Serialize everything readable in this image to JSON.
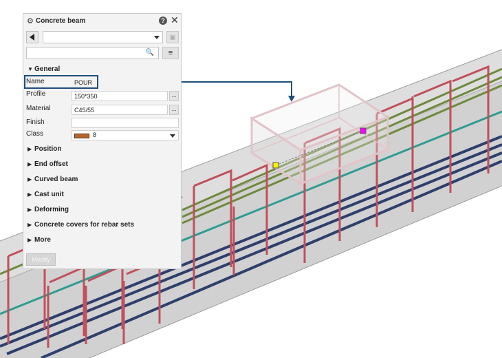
{
  "panel": {
    "title": "Concrete beam",
    "help_glyph": "?",
    "close_glyph": "✕",
    "menu_glyph": "≡",
    "search_glyph": "🔍",
    "modify_label": "Modify"
  },
  "sections": {
    "general": "General",
    "position": "Position",
    "end_offset": "End offset",
    "curved_beam": "Curved beam",
    "cast_unit": "Cast unit",
    "deforming": "Deforming",
    "concrete_covers": "Concrete covers for rebar sets",
    "more": "More"
  },
  "properties": {
    "name_label": "Name",
    "name_value": "POUR",
    "profile_label": "Profile",
    "profile_value": "150*350",
    "material_label": "Material",
    "material_value": "C45/55",
    "finish_label": "Finish",
    "finish_value": "",
    "class_label": "Class",
    "class_value": "8"
  },
  "colors": {
    "highlight": "#1f4e79",
    "class_swatch": "#b5652a",
    "stirrup": "#c0505a",
    "top_bar": "#6e8a3c",
    "bottom_bar": "#2e3f6e",
    "teal_bar": "#2f9c93",
    "pour_outline": "#e2c4c8",
    "handle_start": "#ffee00",
    "handle_end": "#ff00ff"
  },
  "icons": {
    "gear": "gear-icon",
    "help": "help-icon",
    "close": "close-icon",
    "back": "arrow-left-icon",
    "save": "save-icon",
    "search": "search-icon",
    "menu": "menu-icon"
  }
}
